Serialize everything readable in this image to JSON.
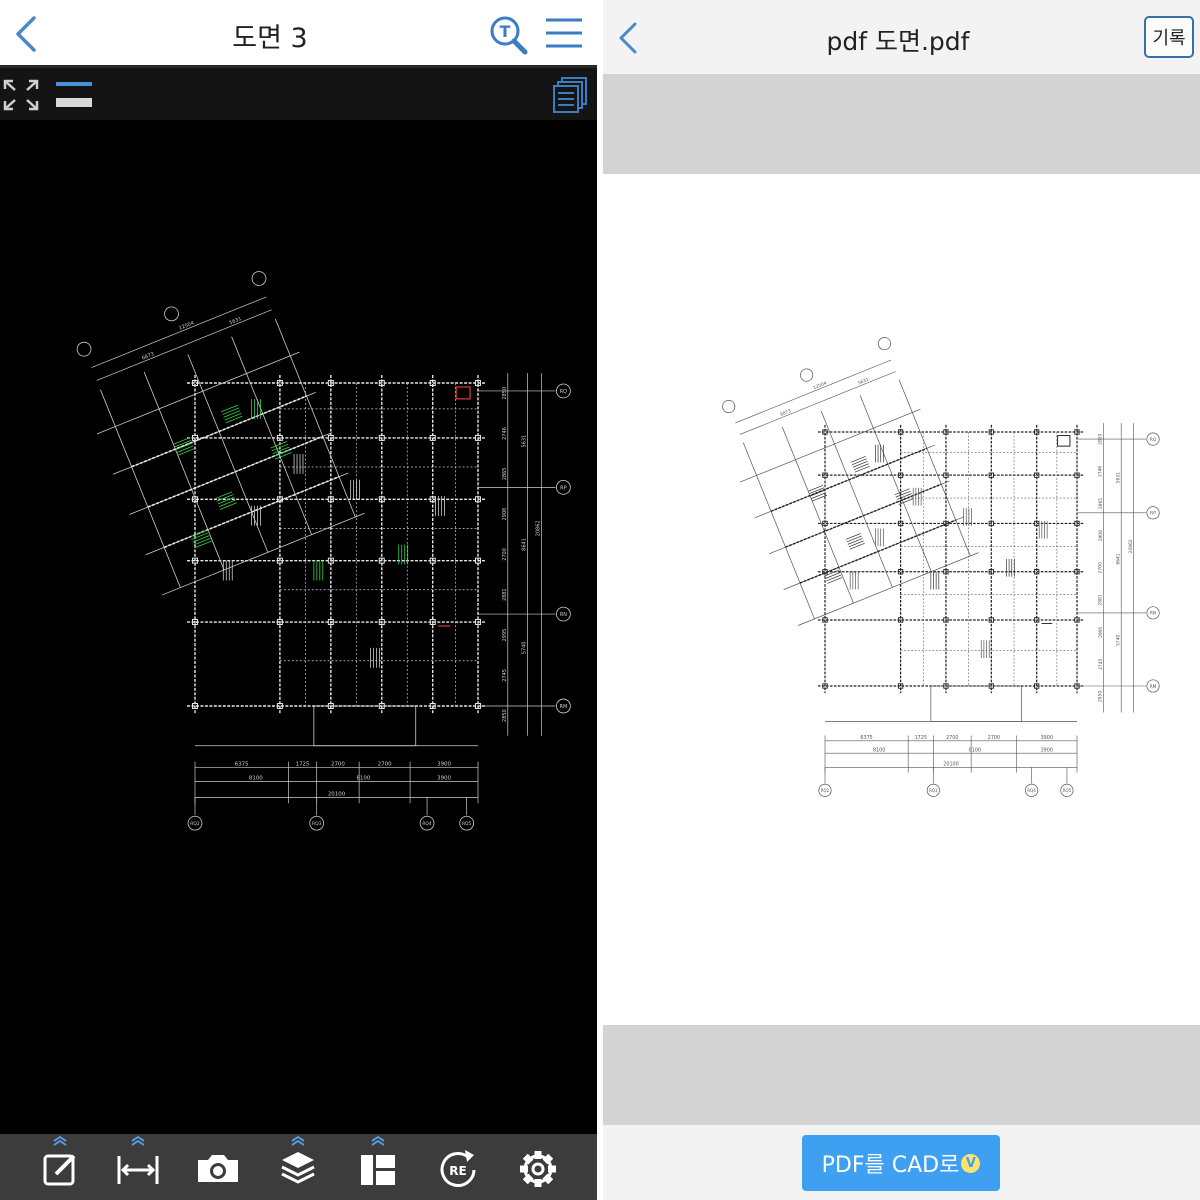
{
  "left_viewer": {
    "title": "도면 3",
    "icons": {
      "back": "chevron-left-icon",
      "text_search": "text-search-icon",
      "menu": "hamburger-menu-icon",
      "fullscreen": "fullscreen-icon",
      "layout": "layout-bars-icon",
      "sheets": "sheets-icon"
    },
    "bottom_tools": [
      {
        "name": "markup-edit-icon"
      },
      {
        "name": "measure-icon"
      },
      {
        "name": "camera-icon"
      },
      {
        "name": "layers-icon"
      },
      {
        "name": "layout-panel-icon"
      },
      {
        "name": "regenerate-icon",
        "label": "RE"
      },
      {
        "name": "settings-icon"
      }
    ],
    "drawing": {
      "grid_bubbles_bottom": [
        "RQ2",
        "RQ3",
        "RQ4",
        "RQ5"
      ],
      "grid_bubbles_right": [
        "RQ",
        "RP",
        "RN",
        "RM"
      ],
      "dims_bottom_row1": [
        "6375",
        "1725",
        "2700",
        "2700",
        "3900"
      ],
      "dims_bottom_row2": [
        "8100",
        "8100",
        "3900"
      ],
      "dims_bottom_total": "20100",
      "dims_right": [
        "2850",
        "2746",
        "2865",
        "2908",
        "2700",
        "2881",
        "2995",
        "2745",
        "2850"
      ],
      "dims_right_outer": [
        "5631",
        "8641",
        "5740"
      ],
      "dims_right_total": "20862",
      "dims_top": [
        "6873",
        "12504",
        "5631"
      ]
    },
    "colors": {
      "bg": "#000000",
      "line": "#cfcfcf",
      "beam": "#e8e8e8",
      "green": "#3bd24a",
      "red": "#e23a3a"
    }
  },
  "right_viewer": {
    "title": "pdf 도면.pdf",
    "history_label": "기록",
    "convert_label": "PDF를 CAD로",
    "convert_badge": "V",
    "icons": {
      "back": "chevron-left-icon"
    },
    "colors": {
      "accent": "#3fa0f1",
      "badge": "#ffe36a"
    }
  }
}
